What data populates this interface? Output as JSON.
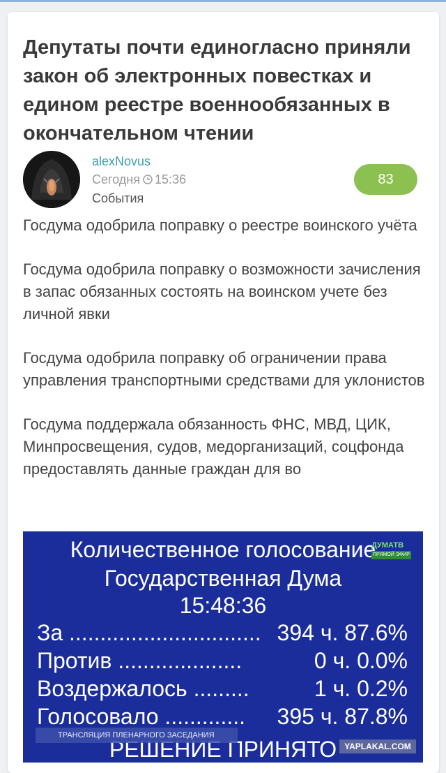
{
  "article": {
    "title": "Депутаты почти единогласно приняли закон об электронных повестках и едином реестре военнообязанных в окончательном чтении",
    "author": "alexNovus",
    "date": "Сегодня",
    "time": "15:36",
    "category": "События",
    "rating": "83",
    "paragraphs": [
      "Госдума одобрила поправку о реестре воинского учёта",
      "Госдума одобрила поправку о возможности зачисления в запас обязанных состоять на воинском учете без личной явки",
      "Госдума одобрила поправку об ограничении права управления транспортными средствами для уклонистов",
      "Госдума поддержала обязанность ФНС, МВД, ЦИК, Минпросвещения, судов, медорганизаций, соцфонда предоставлять данные граждан для во"
    ]
  },
  "vote_image": {
    "heading": "Количественное голосование",
    "body": "Государственная Дума",
    "time": "15:48:36",
    "channel_logo": "ДУМАТВ",
    "channel_sub": "ПРЯМОЙ ЭФИР",
    "rows": [
      {
        "label": "За ...............................",
        "value": "394 ч. 87.6%"
      },
      {
        "label": "Против ....................",
        "value": "0 ч.   0.0%"
      },
      {
        "label": "Воздержалось .........",
        "value": "1 ч.   0.2%"
      },
      {
        "label": "Голосовало .............",
        "value": "395 ч. 87.8%"
      }
    ],
    "banner": "ТРАНСЛЯЦИЯ ПЛЕНАРНОГО ЗАСЕДАНИЯ",
    "decision": "РЕШЕНИЕ ПРИНЯТО",
    "watermark": "YAPLAKAL.COM"
  },
  "colors": {
    "author": "#3f9fb3",
    "rating_bg": "#8cc152",
    "vote_bg": "#1b2d9b"
  },
  "icons": [
    "clock-icon"
  ]
}
